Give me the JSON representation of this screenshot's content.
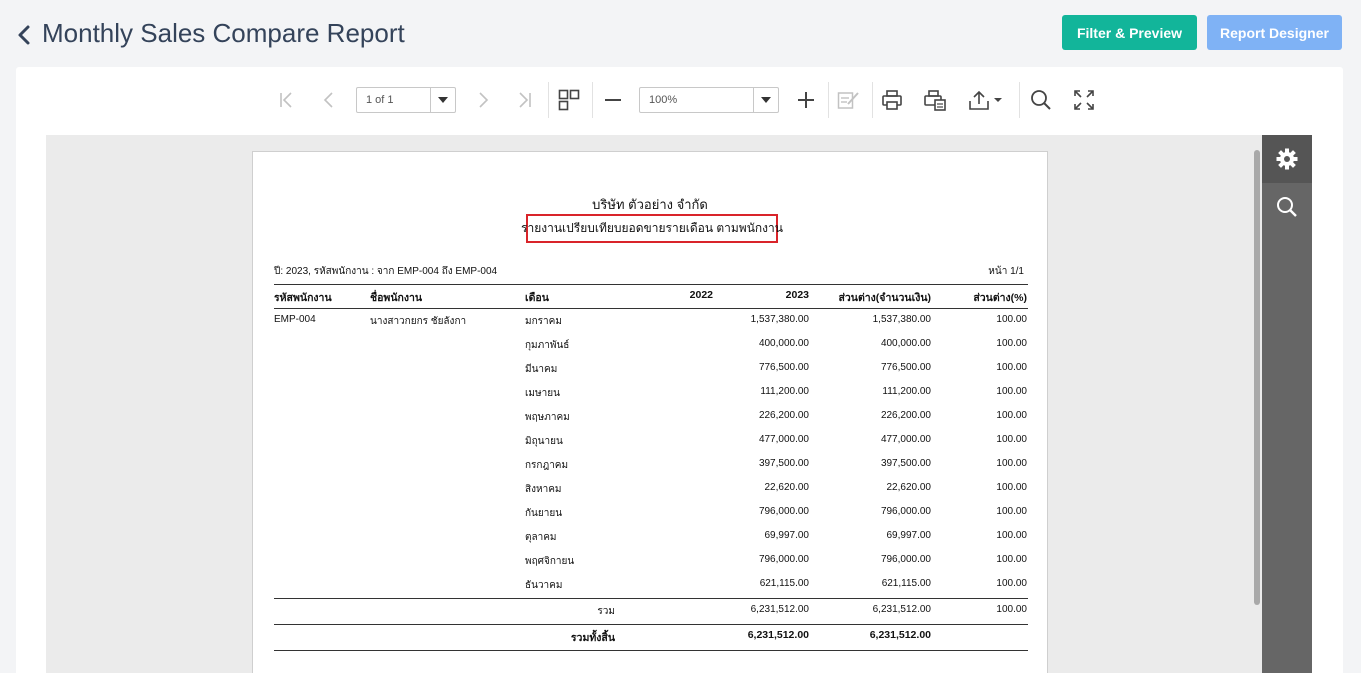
{
  "header": {
    "title": "Monthly Sales Compare Report",
    "filter_button": "Filter & Preview",
    "designer_button": "Report Designer"
  },
  "toolbar": {
    "page_selector": "1 of 1",
    "zoom": "100%",
    "icons": [
      "first-page-icon",
      "previous-page-icon",
      "next-page-icon",
      "last-page-icon",
      "multipage-icon",
      "zoom-out-icon",
      "zoom-in-icon",
      "edit-icon",
      "print-icon",
      "print-page-icon",
      "export-icon",
      "search-icon",
      "fullscreen-icon"
    ]
  },
  "side_panel": {
    "icons": [
      "gear-icon",
      "search-icon"
    ]
  },
  "report": {
    "company": "บริษัท ตัวอย่าง จำกัด",
    "title": "รายงานเปรียบเทียบยอดขายรายเดือน ตามพนักงาน",
    "filter_text": "ปี: 2023, รหัสพนักงาน : จาก EMP-004 ถึง EMP-004",
    "page_text": "หน้า 1/1",
    "columns": {
      "code": "รหัสพนักงาน",
      "name": "ชื่อพนักงาน",
      "month": "เดือน",
      "y2022": "2022",
      "y2023": "2023",
      "diff_amount": "ส่วนต่าง(จำนวนเงิน)",
      "diff_percent": "ส่วนต่าง(%)"
    },
    "employee": {
      "code": "EMP-004",
      "name": "นางสาวกยกร ชัยลังกา"
    },
    "rows": [
      {
        "month": "มกราคม",
        "y2023": "1,537,380.00",
        "diff": "1,537,380.00",
        "pct": "100.00"
      },
      {
        "month": "กุมภาพันธ์",
        "y2023": "400,000.00",
        "diff": "400,000.00",
        "pct": "100.00"
      },
      {
        "month": "มีนาคม",
        "y2023": "776,500.00",
        "diff": "776,500.00",
        "pct": "100.00"
      },
      {
        "month": "เมษายน",
        "y2023": "111,200.00",
        "diff": "111,200.00",
        "pct": "100.00"
      },
      {
        "month": "พฤษภาคม",
        "y2023": "226,200.00",
        "diff": "226,200.00",
        "pct": "100.00"
      },
      {
        "month": "มิถุนายน",
        "y2023": "477,000.00",
        "diff": "477,000.00",
        "pct": "100.00"
      },
      {
        "month": "กรกฎาคม",
        "y2023": "397,500.00",
        "diff": "397,500.00",
        "pct": "100.00"
      },
      {
        "month": "สิงหาคม",
        "y2023": "22,620.00",
        "diff": "22,620.00",
        "pct": "100.00"
      },
      {
        "month": "กันยายน",
        "y2023": "796,000.00",
        "diff": "796,000.00",
        "pct": "100.00"
      },
      {
        "month": "ตุลาคม",
        "y2023": "69,997.00",
        "diff": "69,997.00",
        "pct": "100.00"
      },
      {
        "month": "พฤศจิกายน",
        "y2023": "796,000.00",
        "diff": "796,000.00",
        "pct": "100.00"
      },
      {
        "month": "ธันวาคม",
        "y2023": "621,115.00",
        "diff": "621,115.00",
        "pct": "100.00"
      }
    ],
    "subtotal": {
      "label": "รวม",
      "y2023": "6,231,512.00",
      "diff": "6,231,512.00",
      "pct": "100.00"
    },
    "grandtotal": {
      "label": "รวมทั้งสิ้น",
      "y2023": "6,231,512.00",
      "diff": "6,231,512.00"
    }
  }
}
